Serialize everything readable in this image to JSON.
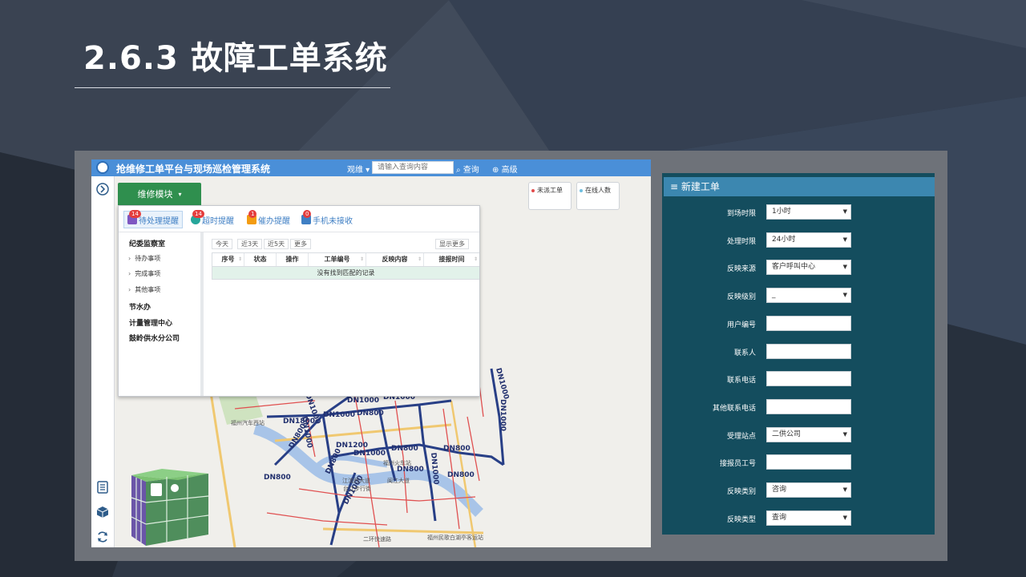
{
  "slide": {
    "title": "2.6.3 故障工单系统"
  },
  "app": {
    "title": "抢维修工单平台与现场巡检管理系统",
    "view_select": "观维",
    "search_placeholder": "请输入查询内容",
    "query_label": "查询",
    "advanced_label": "高级",
    "module_label": "维修模块",
    "status_cards": [
      {
        "label": "未派工单",
        "color": "#e24b4b"
      },
      {
        "label": "在线人数",
        "color": "#6fbfe0"
      }
    ],
    "tabs": [
      {
        "label": "待处理提醒",
        "badge": "14",
        "icon": "clipboard-icon"
      },
      {
        "label": "超时提醒",
        "badge": "14",
        "icon": "clock-icon"
      },
      {
        "label": "催办提醒",
        "badge": "1",
        "icon": "bell-icon"
      },
      {
        "label": "手机未接收",
        "badge": "0",
        "icon": "phone-icon"
      }
    ],
    "departments": [
      {
        "label": "纪委监察室",
        "children": [
          "待办事项",
          "完成事项",
          "其他事项"
        ]
      },
      {
        "label": "节水办"
      },
      {
        "label": "计量管理中心"
      },
      {
        "label": "鼓岭供水分公司"
      }
    ],
    "filters": [
      "今天",
      "近3天",
      "近5天",
      "更多"
    ],
    "show_more": "显示更多",
    "columns": [
      "序号",
      "状态",
      "操作",
      "工单编号",
      "反映内容",
      "接报时间"
    ],
    "empty_text": "没有找到匹配的记录",
    "map_labels": {
      "pipes": [
        "DN1000",
        "DN1000",
        "DN1000",
        "DN800",
        "DN1000",
        "DN1800",
        "DN1000",
        "DN800",
        "DN1200",
        "DN1000",
        "DN800",
        "DN800",
        "DN800",
        "DN800",
        "DN800",
        "DN1000",
        "DN1000",
        "DN1000",
        "DN1000",
        "DN800"
      ],
      "places": [
        "福州汽车西站",
        "福州火车站",
        "江滨西大道",
        "台江步行街",
        "闽江大道",
        "福州民歌白湖亭客运站",
        "二环快速路"
      ]
    }
  },
  "form": {
    "header": "≡ 新建工单",
    "fields": [
      {
        "label": "到场时限",
        "value": "1小时",
        "type": "select"
      },
      {
        "label": "处理时限",
        "value": "24小时",
        "type": "select"
      },
      {
        "label": "反映来源",
        "value": "客户呼叫中心",
        "type": "select"
      },
      {
        "label": "反映级别",
        "value": "_",
        "type": "select"
      },
      {
        "label": "用户编号",
        "value": "",
        "type": "text"
      },
      {
        "label": "联系人",
        "value": "",
        "type": "text"
      },
      {
        "label": "联系电话",
        "value": "",
        "type": "text"
      },
      {
        "label": "其他联系电话",
        "value": "",
        "type": "text"
      },
      {
        "label": "受理站点",
        "value": "二供公司",
        "type": "select"
      },
      {
        "label": "接报员工号",
        "value": "",
        "type": "text"
      },
      {
        "label": "反映类别",
        "value": "咨询",
        "type": "select"
      },
      {
        "label": "反映类型",
        "value": "查询",
        "type": "select"
      }
    ]
  }
}
